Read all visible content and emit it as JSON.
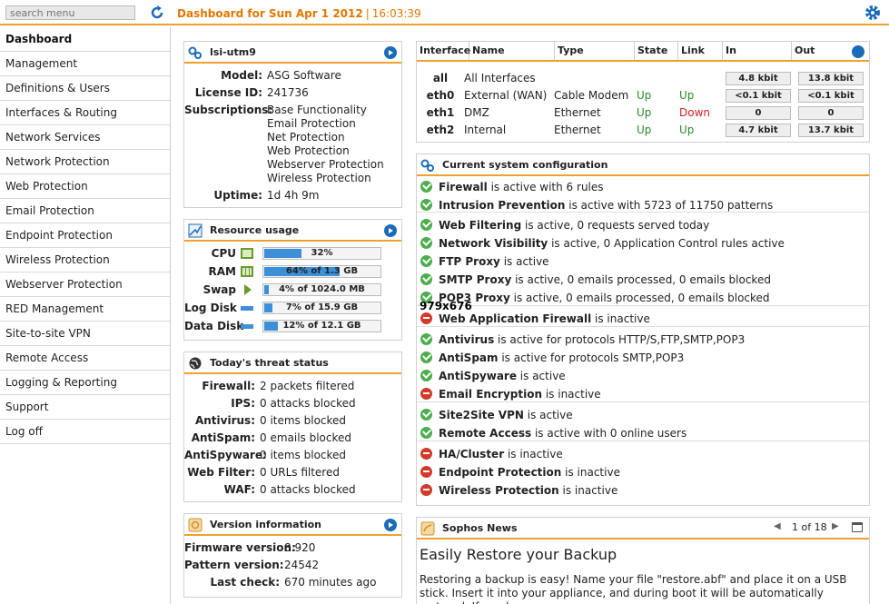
{
  "header": {
    "search_placeholder": "search menu",
    "title": "Dashboard for Sun Apr 1 2012",
    "separator": "|",
    "time": "16:03:39"
  },
  "sidebar": {
    "items": [
      "Dashboard",
      "Management",
      "Definitions & Users",
      "Interfaces & Routing",
      "Network Services",
      "Network Protection",
      "Web Protection",
      "Email Protection",
      "Endpoint Protection",
      "Wireless Protection",
      "Webserver Protection",
      "RED Management",
      "Site-to-site VPN",
      "Remote Access",
      "Logging & Reporting",
      "Support",
      "Log off"
    ]
  },
  "device": {
    "title": "lsi-utm9",
    "model_label": "Model:",
    "model": "ASG Software",
    "license_label": "License ID:",
    "license": "241736",
    "subs_label": "Subscriptions:",
    "subs": [
      "Base Functionality",
      "Email Protection",
      "Net Protection",
      "Web Protection",
      "Webserver Protection",
      "Wireless Protection"
    ],
    "uptime_label": "Uptime:",
    "uptime": "1d 4h 9m"
  },
  "resources": {
    "title": "Resource usage",
    "rows": [
      {
        "label": "CPU",
        "text": "32%",
        "pct": 32
      },
      {
        "label": "RAM",
        "text": "64% of 1.3 GB",
        "pct": 64
      },
      {
        "label": "Swap",
        "text": "4% of 1024.0 MB",
        "pct": 4
      },
      {
        "label": "Log Disk",
        "text": "7% of 15.9 GB",
        "pct": 7
      },
      {
        "label": "Data Disk",
        "text": "12% of 12.1 GB",
        "pct": 12
      }
    ]
  },
  "threats": {
    "title": "Today's threat status",
    "rows": [
      {
        "label": "Firewall:",
        "value": "2 packets filtered"
      },
      {
        "label": "IPS:",
        "value": "0 attacks blocked"
      },
      {
        "label": "Antivirus:",
        "value": "0 items blocked"
      },
      {
        "label": "AntiSpam:",
        "value": "0 emails blocked"
      },
      {
        "label": "AntiSpyware:",
        "value": "0 items blocked"
      },
      {
        "label": "Web Filter:",
        "value": "0 URLs filtered"
      },
      {
        "label": "WAF:",
        "value": "0 attacks blocked"
      }
    ]
  },
  "version": {
    "title": "Version information",
    "rows": [
      {
        "label": "Firmware version:",
        "value": "8.920"
      },
      {
        "label": "Pattern version:",
        "value": "24542"
      },
      {
        "label": "Last check:",
        "value": "670 minutes ago"
      }
    ]
  },
  "interfaces": {
    "headers": [
      "Interface",
      "Name",
      "Type",
      "State",
      "Link",
      "In",
      "Out"
    ],
    "rows": [
      {
        "iface": "all",
        "name": "All Interfaces",
        "type": "",
        "state": "",
        "link": "",
        "link_status": "",
        "in": "4.8 kbit",
        "out": "13.8 kbit"
      },
      {
        "iface": "eth0",
        "name": "External (WAN)",
        "type": "Cable Modem",
        "state": "Up",
        "link": "Up",
        "link_status": "up",
        "in": "<0.1 kbit",
        "out": "<0.1 kbit"
      },
      {
        "iface": "eth1",
        "name": "DMZ",
        "type": "Ethernet",
        "state": "Up",
        "link": "Down",
        "link_status": "down",
        "in": "0",
        "out": "0"
      },
      {
        "iface": "eth2",
        "name": "Internal",
        "type": "Ethernet",
        "state": "Up",
        "link": "Up",
        "link_status": "up",
        "in": "4.7 kbit",
        "out": "13.7 kbit"
      }
    ]
  },
  "sysconfig": {
    "title": "Current system configuration",
    "items": [
      {
        "ok": true,
        "name": "Firewall",
        "text": " is active with 6 rules"
      },
      {
        "ok": true,
        "name": "Intrusion Prevention",
        "text": " is active with 5723 of 11750 patterns"
      },
      {
        "ok": true,
        "name": "Web Filtering",
        "text": " is active, 0 requests served today"
      },
      {
        "ok": true,
        "name": "Network Visibility",
        "text": " is active, 0 Application Control rules active"
      },
      {
        "ok": true,
        "name": "FTP Proxy",
        "text": " is active"
      },
      {
        "ok": true,
        "name": "SMTP Proxy",
        "text": " is active, 0 emails processed, 0 emails blocked"
      },
      {
        "ok": true,
        "name": "POP3 Proxy",
        "text": " is active, 0 emails processed, 0 emails blocked"
      },
      {
        "ok": false,
        "name": "Web Application Firewall",
        "text": " is inactive"
      },
      {
        "ok": true,
        "name": "Antivirus",
        "text": " is active for protocols HTTP/S,FTP,SMTP,POP3"
      },
      {
        "ok": true,
        "name": "AntiSpam",
        "text": " is active for protocols SMTP,POP3"
      },
      {
        "ok": true,
        "name": "AntiSpyware",
        "text": " is active"
      },
      {
        "ok": false,
        "name": "Email Encryption",
        "text": " is inactive"
      },
      {
        "ok": true,
        "name": "Site2Site VPN",
        "text": " is active"
      },
      {
        "ok": true,
        "name": "Remote Access",
        "text": " is active with 0 online users"
      },
      {
        "ok": false,
        "name": "HA/Cluster",
        "text": " is inactive"
      },
      {
        "ok": false,
        "name": "Endpoint Protection",
        "text": " is inactive"
      },
      {
        "ok": false,
        "name": "Wireless Protection",
        "text": " is inactive"
      }
    ]
  },
  "overlay_text": "979x676",
  "news": {
    "title": "Sophos News",
    "pager": "1 of 18",
    "headline": "Easily Restore your Backup",
    "body": "Restoring a backup is easy! Name your file \"restore.abf\" and place it on a USB stick. Insert it into your appliance, and during boot it will be automatically restored. If you have an"
  },
  "colors": {
    "accent": "#f0a030",
    "title": "#e07800",
    "link": "#1a6bb8",
    "ok": "#4cae4c",
    "error": "#d23a2a"
  }
}
